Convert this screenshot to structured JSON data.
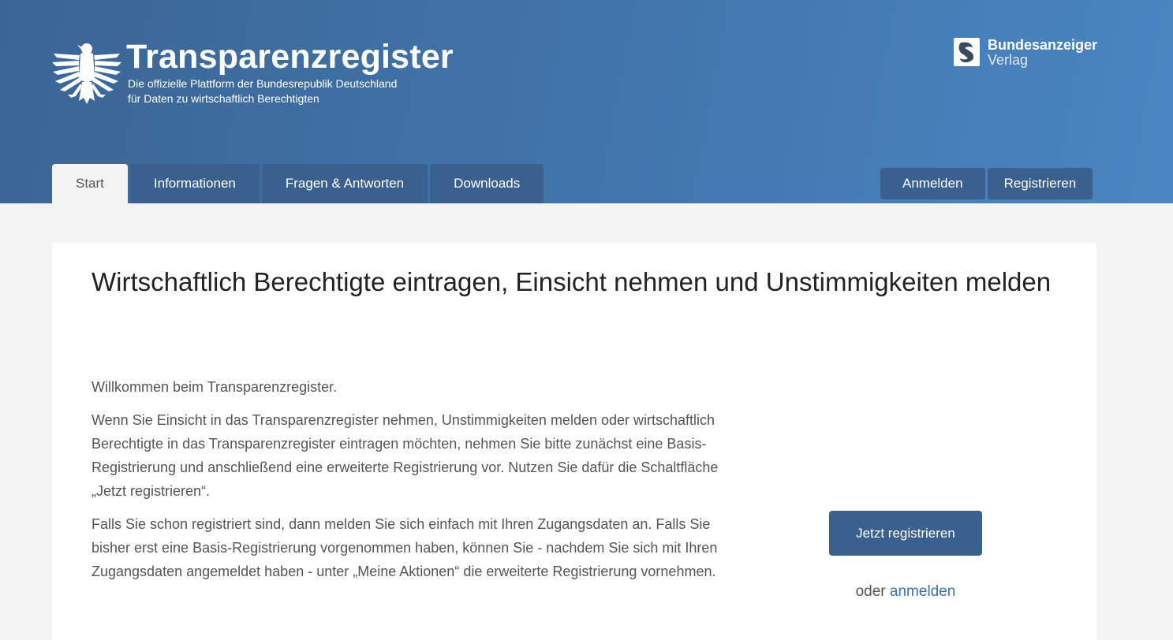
{
  "header": {
    "title": "Transparenzregister",
    "subtitle_line1": "Die offizielle Plattform der Bundesrepublik Deutschland",
    "subtitle_line2": "für Daten zu wirtschaftlich Berechtigten",
    "logo_icon": "federal-eagle-icon",
    "publisher_name": "Bundesanzeiger",
    "publisher_sub": "Verlag",
    "publisher_icon": "bundesanzeiger-logo-icon"
  },
  "nav": {
    "tabs": [
      {
        "label": "Start",
        "active": true
      },
      {
        "label": "Informationen",
        "active": false
      },
      {
        "label": "Fragen & Antworten",
        "active": false
      },
      {
        "label": "Downloads",
        "active": false
      }
    ],
    "login_label": "Anmelden",
    "register_label": "Registrieren"
  },
  "main": {
    "headline": "Wirtschaftlich Berechtigte eintragen, Einsicht nehmen und Unstimmigkeiten melden",
    "paragraphs": [
      "Willkommen beim Transparenzregister.",
      "Wenn Sie Einsicht in das Transparenzregister nehmen, Unstimmigkeiten melden oder wirtschaftlich Berechtigte in das Transparenzregister eintragen möchten, nehmen Sie bitte zunächst eine Basis-Registrierung und anschließend eine erweiterte Registrierung vor. Nutzen Sie dafür die Schaltfläche „Jetzt registrieren“.",
      "Falls Sie schon registriert sind, dann melden Sie sich einfach mit Ihren Zugangsdaten an. Falls Sie bisher erst eine Basis-Registrierung vorgenommen haben, können Sie - nachdem Sie sich mit Ihren Zugangsdaten angemeldet haben - unter „Meine Aktionen“ die erweiterte Registrierung vornehmen."
    ],
    "cta_label": "Jetzt registrieren",
    "alt_prefix": "oder",
    "alt_link": "anmelden"
  },
  "colors": {
    "header_gradient_start": "#3b6595",
    "header_gradient_end": "#4a86c2",
    "button": "#3a6090",
    "link": "#3a70aa",
    "page_bg": "#f4f4f4"
  }
}
